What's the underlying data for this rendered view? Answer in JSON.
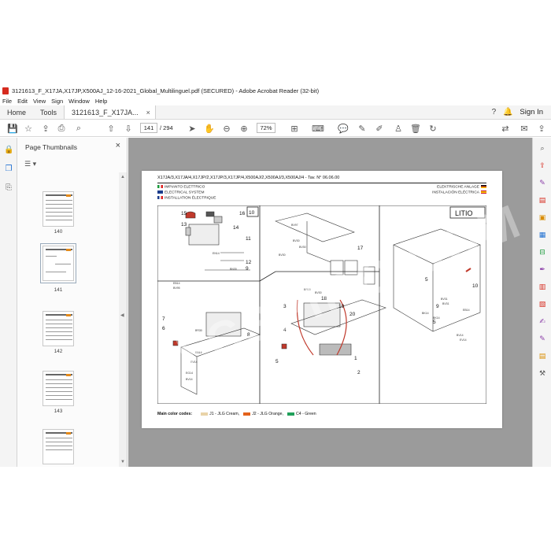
{
  "window": {
    "title": "3121613_F_X17JA,X17JP,X500AJ_12-16-2021_Global_Multilinguel.pdf (SECURED) - Adobe Acrobat Reader (32-bit)"
  },
  "menu": [
    "File",
    "Edit",
    "View",
    "Sign",
    "Window",
    "Help"
  ],
  "tabs": {
    "home": "Home",
    "tools": "Tools",
    "document": "3121613_F_X17JA...",
    "close": "×",
    "sign_in": "Sign In"
  },
  "toolbar": {
    "current_page": "141",
    "page_total": "/ 294",
    "zoom": "72%"
  },
  "panel": {
    "title": "Page Thumbnails",
    "close": "×",
    "options": "☰ ▾",
    "thumbnails": [
      {
        "label": "140"
      },
      {
        "label": "141"
      },
      {
        "label": "142"
      },
      {
        "label": "143"
      }
    ]
  },
  "document_page": {
    "header": "X17JA/3,X17JA/4,X17JP/2,X17JP/3,X17JP/4,X500AJ/2,X500AJ/3,X500AJ/4 - Tav. N° 06.06.00",
    "lang_left": [
      "IMPIANTO ELETTRICO",
      "ELECTRICAL SYSTEM",
      "INSTALLATION ÉLECTRIQUE"
    ],
    "lang_right": [
      "ELEKTRISCHE ANLAGE",
      "INSTALACIÓN ELÉCTRICA"
    ],
    "box_10": "10",
    "box_litio": "LITIO",
    "callouts": [
      "15",
      "16",
      "13",
      "14",
      "11",
      "12",
      "9",
      "7",
      "6",
      "8",
      "3",
      "1",
      "5",
      "4",
      "2",
      "17",
      "18",
      "19",
      "20",
      "5",
      "9",
      "5",
      "10"
    ],
    "small_labels": [
      "BV97",
      "BV30",
      "BV30",
      "BR15",
      "BV30",
      "BV30",
      "BV31",
      "EN14",
      "BN30",
      "BV31",
      "EB14",
      "BV95",
      "EB14",
      "BK14",
      "BK14",
      "EG14",
      "BV14",
      "BV14",
      "EV14",
      "BR30",
      "EV14",
      "EB14"
    ],
    "legend": {
      "title": "Main color codes:",
      "items": [
        {
          "code": "J1",
          "name": "JLG Cream,",
          "color": "#e9d3a8"
        },
        {
          "code": "J2",
          "name": "JLG Orange,",
          "color": "#e3621b"
        },
        {
          "code": "C4",
          "name": "Green",
          "color": "#20a05a"
        }
      ]
    }
  },
  "watermark": "FCSPIRO.COM",
  "colors": {
    "accent": "#1f6fd1",
    "acrobat_red": "#d62b1f"
  }
}
